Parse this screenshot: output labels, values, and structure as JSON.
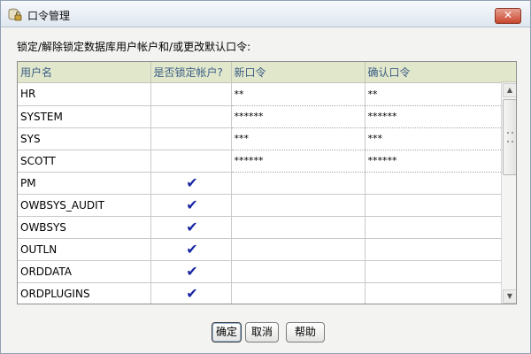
{
  "window": {
    "title": "口令管理",
    "close_label": "✕"
  },
  "instruction": "锁定/解除锁定数据库用户帐户和/或更改默认口令:",
  "table": {
    "columns": [
      "用户名",
      "是否锁定帐户?",
      "新口令",
      "确认口令"
    ],
    "rows": [
      {
        "user": "HR",
        "locked": false,
        "new_password": "**",
        "confirm_password": "**"
      },
      {
        "user": "SYSTEM",
        "locked": false,
        "new_password": "******",
        "confirm_password": "******"
      },
      {
        "user": "SYS",
        "locked": false,
        "new_password": "***",
        "confirm_password": "***"
      },
      {
        "user": "SCOTT",
        "locked": false,
        "new_password": "******",
        "confirm_password": "******"
      },
      {
        "user": "PM",
        "locked": true,
        "new_password": "",
        "confirm_password": ""
      },
      {
        "user": "OWBSYS_AUDIT",
        "locked": true,
        "new_password": "",
        "confirm_password": ""
      },
      {
        "user": "OWBSYS",
        "locked": true,
        "new_password": "",
        "confirm_password": ""
      },
      {
        "user": "OUTLN",
        "locked": true,
        "new_password": "",
        "confirm_password": ""
      },
      {
        "user": "ORDDATA",
        "locked": true,
        "new_password": "",
        "confirm_password": ""
      },
      {
        "user": "ORDPLUGINS",
        "locked": true,
        "new_password": "",
        "confirm_password": ""
      }
    ],
    "lock_mark": "✔"
  },
  "buttons": {
    "ok": "确定",
    "cancel": "取消",
    "help": "帮助"
  },
  "colors": {
    "header_bg": "#e0e7cb",
    "header_text": "#3d5d86",
    "checkmark": "#1a28a3"
  }
}
